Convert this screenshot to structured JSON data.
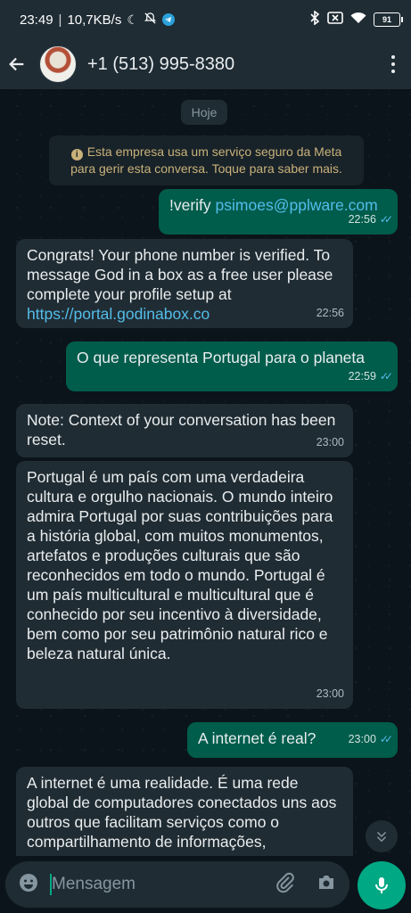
{
  "status": {
    "time": "23:49",
    "speed": "10,7KB/s",
    "battery": "91"
  },
  "header": {
    "title": "+1 (513) 995-8380"
  },
  "chat": {
    "date_pill": "Hoje",
    "notice": "Esta empresa usa um serviço seguro da Meta para gerir esta conversa. Toque para saber mais.",
    "messages": [
      {
        "dir": "out",
        "prefix": "!verify ",
        "link": "psimoes@pplware.com",
        "time": "22:56"
      },
      {
        "dir": "in",
        "text": "Congrats! Your phone number is verified. To message God in a box as a free user please complete your profile setup at ",
        "link": "https://portal.godinabox.co",
        "time": "22:56"
      },
      {
        "dir": "out",
        "text": "O que representa Portugal para o planeta",
        "time": "22:59"
      },
      {
        "dir": "in",
        "text": "Note: Context of your conversation has been reset.",
        "time": "23:00"
      },
      {
        "dir": "in",
        "text": "Portugal é um país com uma verdadeira cultura e orgulho nacionais. O mundo inteiro admira Portugal por suas contribuições para a história global, com muitos monumentos, artefatos e produções culturais que são reconhecidos em todo o mundo. Portugal é um país multicultural e multicultural que é conhecido por seu incentivo à diversidade, bem como por seu patrimônio natural rico e beleza natural única.",
        "time": "23:00"
      },
      {
        "dir": "out",
        "text": "A internet é real?",
        "time": "23:00"
      },
      {
        "dir": "in",
        "text": "A internet é uma realidade. É uma rede global de computadores conectados uns aos outros que facilitam serviços como o compartilhamento de informações,"
      }
    ]
  },
  "composer": {
    "placeholder": "Mensagem"
  },
  "colors": {
    "outgoing_bubble": "#005c4b",
    "incoming_bubble": "#202c33",
    "accent": "#00a884",
    "link": "#53bdeb"
  },
  "icons": [
    "moon-icon",
    "bell-off-icon",
    "telegram-icon",
    "bluetooth-icon",
    "sim-off-icon",
    "wifi-icon",
    "battery-icon",
    "back-arrow-icon",
    "more-vert-icon",
    "info-icon",
    "double-check-icon",
    "chevrons-down-icon",
    "emoji-icon",
    "attach-icon",
    "camera-icon",
    "mic-icon"
  ]
}
